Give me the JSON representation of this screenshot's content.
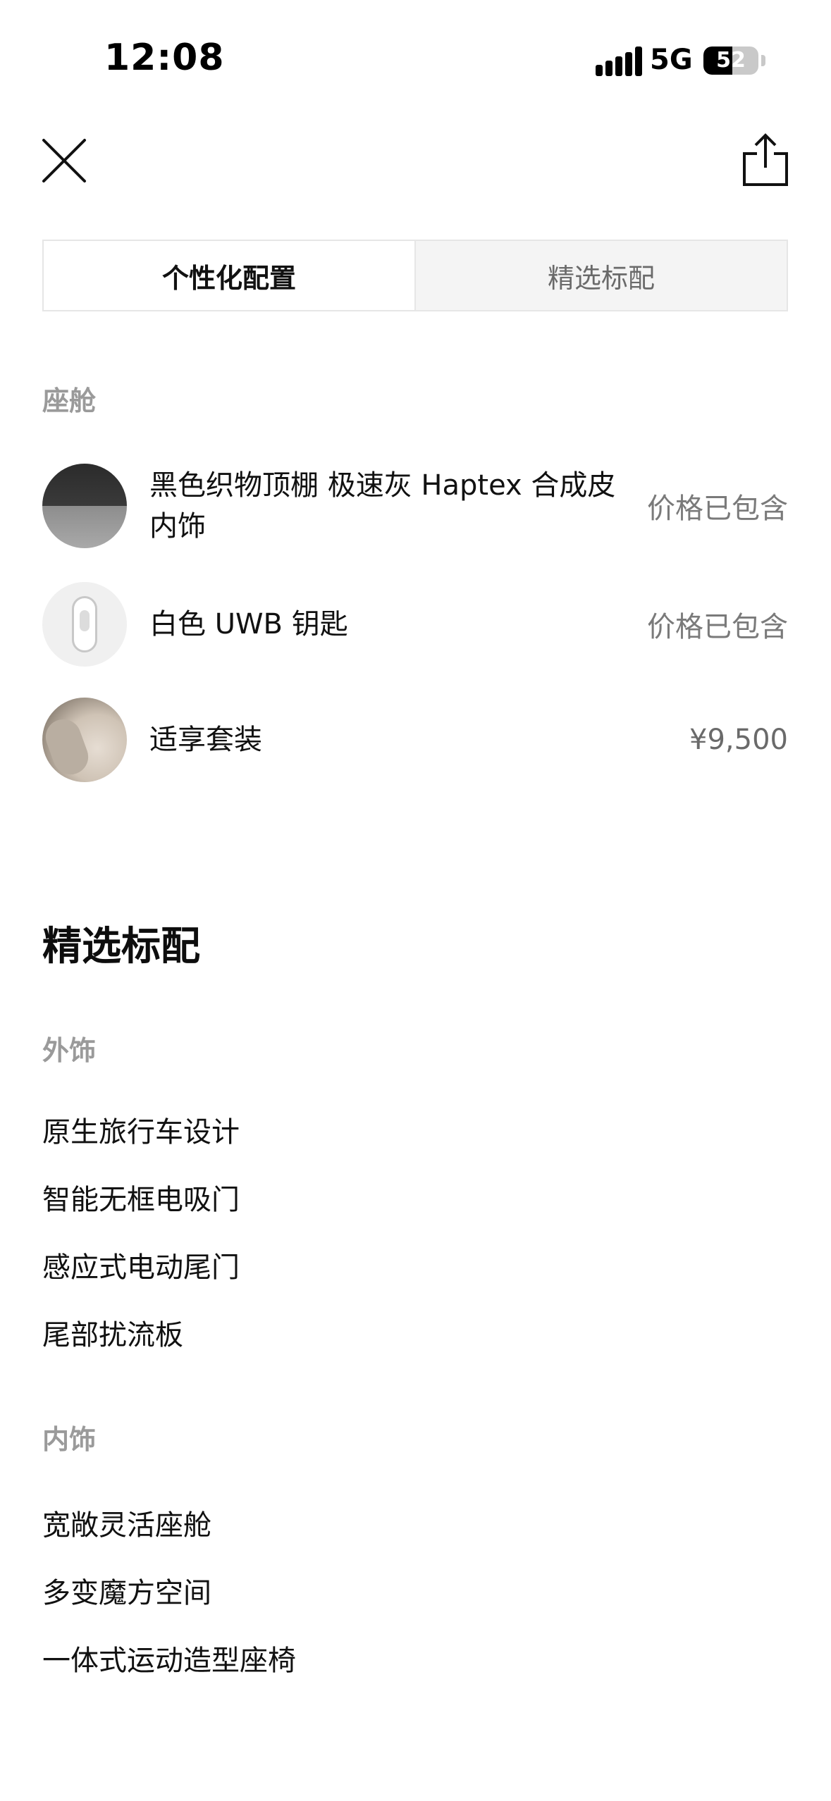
{
  "status_bar": {
    "time": "12:08",
    "network": "5G",
    "battery": "52",
    "battery_level": 0.52
  },
  "tabs": [
    {
      "label": "个性化配置",
      "active": true
    },
    {
      "label": "精选标配",
      "active": false
    }
  ],
  "cabin": {
    "label": "座舱",
    "items": [
      {
        "name": "黑色织物顶棚 极速灰 Haptex 合成皮内饰",
        "price": "价格已包含",
        "thumb": "interior-swatch"
      },
      {
        "name": "白色 UWB 钥匙",
        "price": "价格已包含",
        "thumb": "uwb-key"
      },
      {
        "name": "适享套装",
        "price": "¥9,500",
        "thumb": "seat-package"
      }
    ]
  },
  "standard": {
    "heading": "精选标配",
    "exterior": {
      "label": "外饰",
      "items": [
        "原生旅行车设计",
        "智能无框电吸门",
        "感应式电动尾门",
        "尾部扰流板"
      ]
    },
    "interior": {
      "label": "内饰",
      "items": [
        "宽敞灵活座舱",
        "多变魔方空间",
        "一体式运动造型座椅"
      ]
    }
  },
  "icons": {
    "close": "close-icon",
    "share": "share-icon"
  },
  "colors": {
    "text": "#111111",
    "muted": "#9a9a9a",
    "price": "#7a7a7a",
    "tab_inactive_bg": "#f4f4f4"
  }
}
